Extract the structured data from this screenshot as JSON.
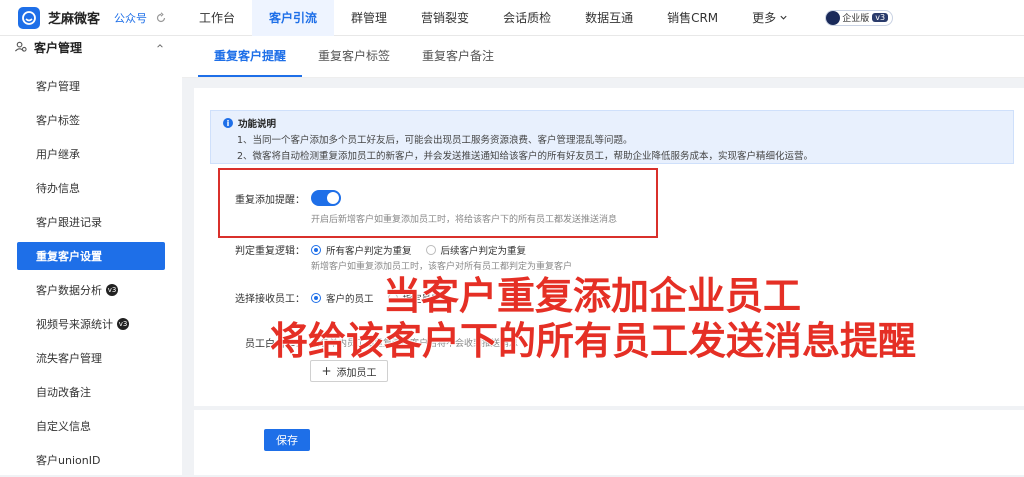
{
  "topbar": {
    "brand": "芝麻微客",
    "account": "公众号",
    "nav": [
      "工作台",
      "客户引流",
      "群管理",
      "营销裂变",
      "会话质检",
      "数据互通",
      "销售CRM"
    ],
    "more_label": "更多",
    "edition_label": "企业版",
    "edition_version": "v3"
  },
  "sidebar": {
    "group_title": "客户管理",
    "items": [
      {
        "label": "客户管理"
      },
      {
        "label": "客户标签"
      },
      {
        "label": "用户继承"
      },
      {
        "label": "待办信息"
      },
      {
        "label": "客户跟进记录"
      },
      {
        "label": "重复客户设置"
      },
      {
        "label": "客户数据分析",
        "badge": "v3"
      },
      {
        "label": "视频号来源统计",
        "badge": "v3"
      },
      {
        "label": "流失客户管理"
      },
      {
        "label": "自动改备注"
      },
      {
        "label": "自定义信息"
      },
      {
        "label": "客户unionID"
      }
    ]
  },
  "tabs": [
    "重复客户提醒",
    "重复客户标签",
    "重复客户备注"
  ],
  "info": {
    "title": "功能说明",
    "line1": "1、当同一个客户添加多个员工好友后，可能会出现员工服务资源浪费、客户管理混乱等问题。",
    "line2": "2、微客将自动检测重复添加员工的新客户，并会发送推送通知给该客户的所有好友员工，帮助企业降低服务成本，实现客户精细化运营。"
  },
  "form": {
    "toggle_label": "重复添加提醒：",
    "toggle_on": true,
    "toggle_hint": "开启后新增客户如重复添加员工时，将给该客户下的所有员工都发送推送消息",
    "logic_label": "判定重复逻辑：",
    "logic_opt1": "所有客户判定为重复",
    "logic_opt2": "后续客户判定为重复",
    "logic_hint": "新增客户如重复添加员工时，该客户对所有员工都判定为重复客户",
    "receiver_label": "选择接收员工：",
    "receiver_opt1": "客户的员工",
    "receiver_opt2": "指定员工",
    "staff_label": "员工白名单：",
    "staff_hint": "白名单内员工如重复添加客户后将不会收到推送消息",
    "add_staff": "添加员工"
  },
  "overlay": {
    "line1": "当客户重复添加企业员工",
    "line2": "将给该客户下的所有员工发送消息提醒"
  },
  "footer": {
    "save": "保存"
  },
  "colors": {
    "accent": "#1e6fe8",
    "overlay_red": "#e52f25",
    "highlight_box": "#d9302b"
  }
}
